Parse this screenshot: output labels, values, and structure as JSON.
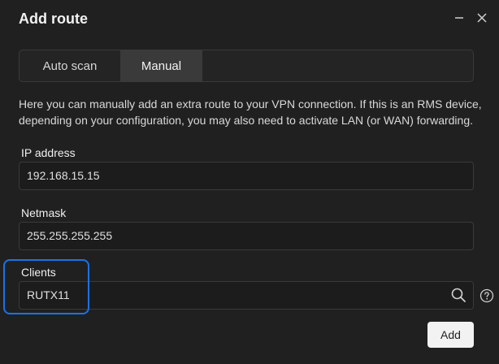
{
  "dialog": {
    "title": "Add route",
    "tabs": [
      {
        "label": "Auto scan",
        "active": false
      },
      {
        "label": "Manual",
        "active": true
      }
    ],
    "description": "Here you can manually add an extra route to your VPN connection. If this is an RMS device, depending on your configuration, you may also need to activate LAN (or WAN) forwarding.",
    "fields": {
      "ip": {
        "label": "IP address",
        "value": "192.168.15.15"
      },
      "netmask": {
        "label": "Netmask",
        "value": "255.255.255.255"
      },
      "clients": {
        "label": "Clients",
        "value": "RUTX11"
      }
    },
    "add_label": "Add"
  },
  "colors": {
    "background": "#202020",
    "highlight": "#1a73e8",
    "active_tab": "#3a3a3a",
    "primary_button": "#f2f2f2"
  },
  "icons": {
    "minimize": "minimize-icon",
    "close": "close-icon",
    "search": "search-icon",
    "help": "help-icon"
  }
}
